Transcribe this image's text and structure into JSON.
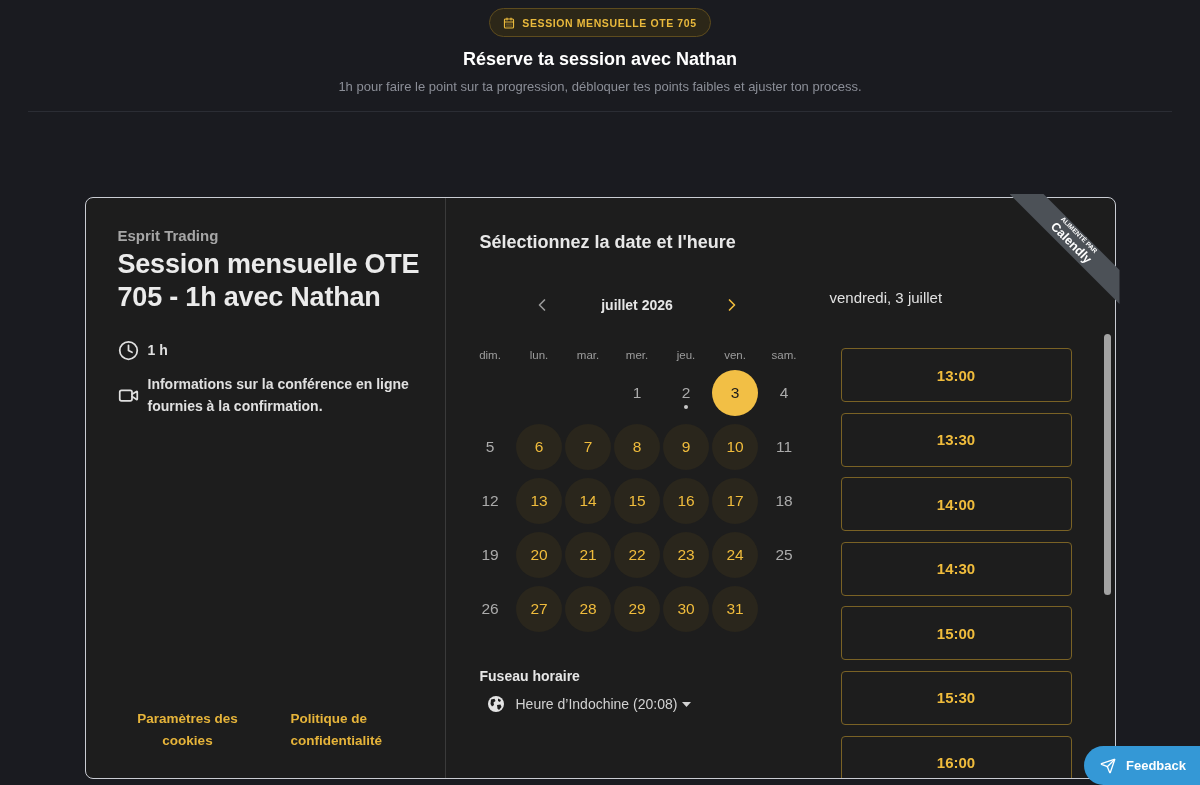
{
  "header": {
    "badge": "SESSION MENSUELLE OTE 705",
    "title": "Réserve ta session avec Nathan",
    "subtitle": "1h pour faire le point sur ta progression, débloquer tes points faibles et ajuster ton process."
  },
  "event": {
    "organizer": "Esprit Trading",
    "title": "Session mensuelle OTE 705 - 1h avec Nathan",
    "details": [
      {
        "kind": "duration",
        "text": "1 h"
      },
      {
        "kind": "video",
        "text": "Informations sur la conférence en ligne fournies à la confirmation."
      }
    ],
    "footer_links": [
      "Paramètres des cookies",
      "Politique de confidentialité"
    ]
  },
  "scheduler": {
    "title": "Sélectionnez la date et l'heure",
    "calendar": {
      "month": "juillet 2026",
      "prev_disabled": true,
      "next_disabled": false,
      "weekdays": [
        "dim.",
        "lun.",
        "mar.",
        "mer.",
        "jeu.",
        "ven.",
        "sam."
      ],
      "weeks": [
        [
          {
            "label": "1",
            "available": false,
            "selected": false,
            "today": false
          },
          {
            "label": "2",
            "available": false,
            "selected": false,
            "today": true
          },
          {
            "label": "3",
            "available": true,
            "selected": true,
            "today": false
          },
          {
            "label": "4",
            "available": false,
            "selected": false,
            "today": false
          }
        ],
        [
          {
            "label": "5",
            "available": false,
            "selected": false,
            "today": false
          },
          {
            "label": "6",
            "available": true,
            "selected": false,
            "today": false
          },
          {
            "label": "7",
            "available": true,
            "selected": false,
            "today": false
          },
          {
            "label": "8",
            "available": true,
            "selected": false,
            "today": false
          },
          {
            "label": "9",
            "available": true,
            "selected": false,
            "today": false
          },
          {
            "label": "10",
            "available": true,
            "selected": false,
            "today": false
          },
          {
            "label": "11",
            "available": false,
            "selected": false,
            "today": false
          }
        ],
        [
          {
            "label": "12",
            "available": false,
            "selected": false,
            "today": false
          },
          {
            "label": "13",
            "available": true,
            "selected": false,
            "today": false
          },
          {
            "label": "14",
            "available": true,
            "selected": false,
            "today": false
          },
          {
            "label": "15",
            "available": true,
            "selected": false,
            "today": false
          },
          {
            "label": "16",
            "available": true,
            "selected": false,
            "today": false
          },
          {
            "label": "17",
            "available": true,
            "selected": false,
            "today": false
          },
          {
            "label": "18",
            "available": false,
            "selected": false,
            "today": false
          }
        ],
        [
          {
            "label": "19",
            "available": false,
            "selected": false,
            "today": false
          },
          {
            "label": "20",
            "available": true,
            "selected": false,
            "today": false
          },
          {
            "label": "21",
            "available": true,
            "selected": false,
            "today": false
          },
          {
            "label": "22",
            "available": true,
            "selected": false,
            "today": false
          },
          {
            "label": "23",
            "available": true,
            "selected": false,
            "today": false
          },
          {
            "label": "24",
            "available": true,
            "selected": false,
            "today": false
          },
          {
            "label": "25",
            "available": false,
            "selected": false,
            "today": false
          }
        ],
        [
          {
            "label": "26",
            "available": false,
            "selected": false,
            "today": false
          },
          {
            "label": "27",
            "available": true,
            "selected": false,
            "today": false
          },
          {
            "label": "28",
            "available": true,
            "selected": false,
            "today": false
          },
          {
            "label": "29",
            "available": true,
            "selected": false,
            "today": false
          },
          {
            "label": "30",
            "available": true,
            "selected": false,
            "today": false
          },
          {
            "label": "31",
            "available": true,
            "selected": false,
            "today": false
          }
        ]
      ]
    },
    "timezone": {
      "label": "Fuseau horaire",
      "value": "Heure d’Indochine (20:08)"
    },
    "slots": {
      "date": "vendredi, 3 juillet",
      "times": [
        {
          "label": "13:00",
          "selected": false
        },
        {
          "label": "13:30",
          "selected": false
        },
        {
          "label": "14:00",
          "selected": false
        },
        {
          "label": "14:30",
          "selected": false
        },
        {
          "label": "15:00",
          "selected": false
        },
        {
          "label": "15:30",
          "selected": false
        },
        {
          "label": "16:00",
          "selected": false
        }
      ]
    }
  },
  "powered_by": {
    "caption": "ALIMENTÉ PAR",
    "brand": "Calendly"
  },
  "feedback_button": "Feedback"
}
